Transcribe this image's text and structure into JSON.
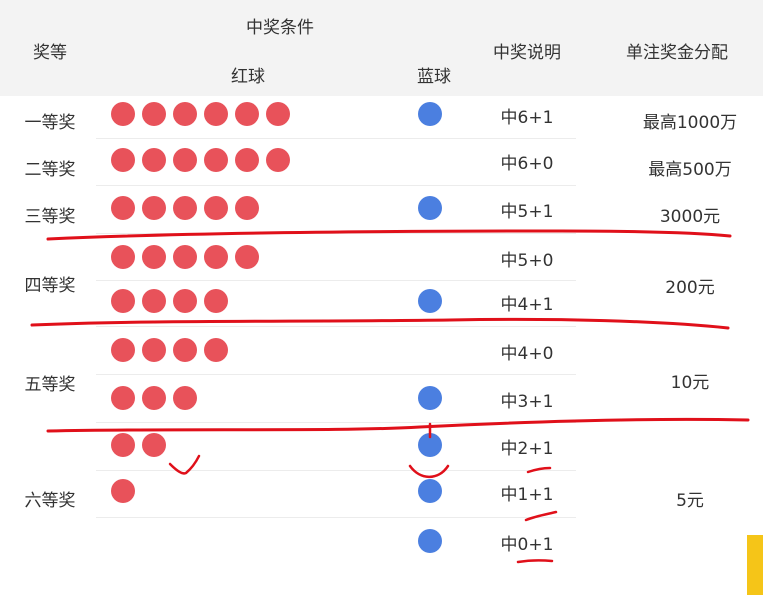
{
  "header": {
    "tier": "奖等",
    "condition": "中奖条件",
    "red": "红球",
    "blue": "蓝球",
    "desc": "中奖说明",
    "prize": "单注奖金分配"
  },
  "tiers": [
    {
      "name": "一等奖",
      "prize": "最高1000万"
    },
    {
      "name": "二等奖",
      "prize": "最高500万"
    },
    {
      "name": "三等奖",
      "prize": "3000元"
    },
    {
      "name": "四等奖",
      "prize": "200元"
    },
    {
      "name": "五等奖",
      "prize": "10元"
    },
    {
      "name": "六等奖",
      "prize": "5元"
    }
  ],
  "rows": [
    {
      "red": 6,
      "blue": 1,
      "desc": "中6+1"
    },
    {
      "red": 6,
      "blue": 0,
      "desc": "中6+0"
    },
    {
      "red": 5,
      "blue": 1,
      "desc": "中5+1"
    },
    {
      "red": 5,
      "blue": 0,
      "desc": "中5+0"
    },
    {
      "red": 4,
      "blue": 1,
      "desc": "中4+1"
    },
    {
      "red": 4,
      "blue": 0,
      "desc": "中4+0"
    },
    {
      "red": 3,
      "blue": 1,
      "desc": "中3+1"
    },
    {
      "red": 2,
      "blue": 1,
      "desc": "中2+1"
    },
    {
      "red": 1,
      "blue": 1,
      "desc": "中1+1"
    },
    {
      "red": 0,
      "blue": 1,
      "desc": "中0+1"
    }
  ],
  "colors": {
    "red_ball": "#e8525a",
    "blue_ball": "#4b7fe0",
    "annotation": "#e0101a",
    "header_bg": "#f3f3f3"
  }
}
